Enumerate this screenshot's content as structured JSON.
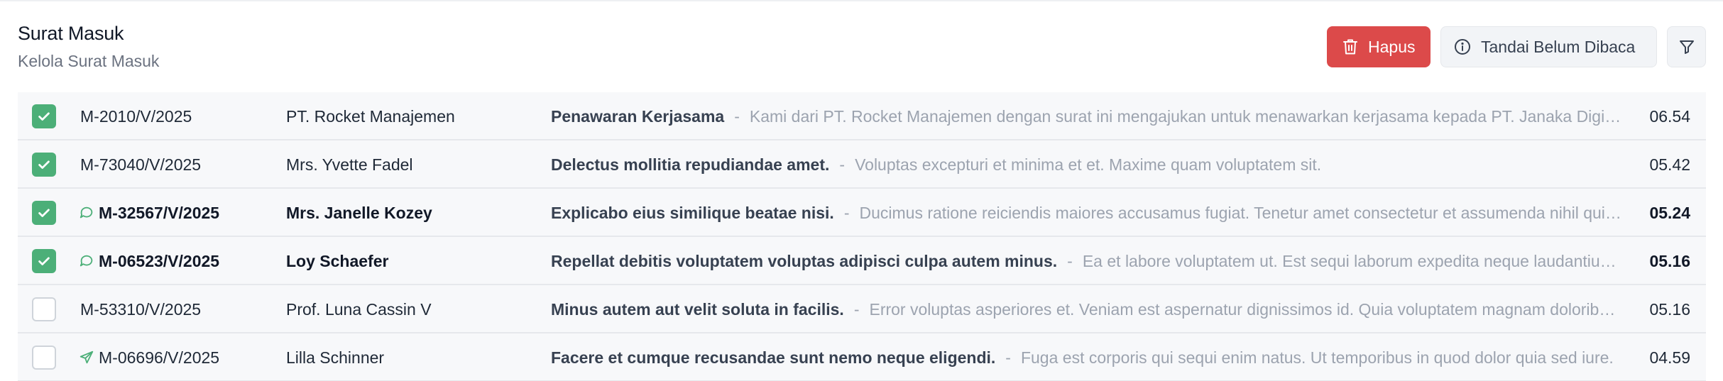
{
  "header": {
    "title": "Surat Masuk",
    "subtitle": "Kelola Surat Masuk",
    "delete_label": "Hapus",
    "mark_unread_label": "Tandai Belum Dibaca",
    "icons": {
      "delete": "trash-icon",
      "mark_unread": "info-circle-icon",
      "filter": "filter-icon"
    },
    "colors": {
      "delete_bg": "#dc4a4a",
      "checkbox_checked": "#4caf78"
    }
  },
  "rows": [
    {
      "checked": true,
      "icon": "",
      "code": "M-2010/V/2025",
      "sender": "PT. Rocket Manajemen",
      "subject": "Penawaran Kerjasama",
      "separator": "-",
      "preview": "Kami dari PT. Rocket Manajemen dengan surat ini mengajukan untuk menawarkan kerjasama kepada PT. Janaka Digital Solusindo untuk pengembangan produk",
      "time": "06.54",
      "unread": false
    },
    {
      "checked": true,
      "icon": "",
      "code": "M-73040/V/2025",
      "sender": "Mrs. Yvette Fadel",
      "subject": "Delectus mollitia repudiandae amet.",
      "separator": "-",
      "preview": "Voluptas excepturi et minima et et. Maxime quam voluptatem sit.",
      "time": "05.42",
      "unread": false
    },
    {
      "checked": true,
      "icon": "chat-bubble-icon",
      "code": "M-32567/V/2025",
      "sender": "Mrs. Janelle Kozey",
      "subject": "Explicabo eius similique beatae nisi.",
      "separator": "-",
      "preview": "Ducimus ratione reiciendis maiores accusamus fugiat. Tenetur amet consectetur et assumenda nihil quia aut.",
      "time": "05.24",
      "unread": true
    },
    {
      "checked": true,
      "icon": "chat-bubble-icon",
      "code": "M-06523/V/2025",
      "sender": "Loy Schaefer",
      "subject": "Repellat debitis voluptatem voluptas adipisci culpa autem minus.",
      "separator": "-",
      "preview": "Ea et labore voluptatem ut. Est sequi laborum expedita neque laudantium repellat.",
      "time": "05.16",
      "unread": true
    },
    {
      "checked": false,
      "icon": "",
      "code": "M-53310/V/2025",
      "sender": "Prof. Luna Cassin V",
      "subject": "Minus autem aut velit soluta in facilis.",
      "separator": "-",
      "preview": "Error voluptas asperiores et. Veniam est aspernatur dignissimos id. Quia voluptatem magnam doloribus qui.",
      "time": "05.16",
      "unread": false
    },
    {
      "checked": false,
      "icon": "send-icon",
      "code": "M-06696/V/2025",
      "sender": "Lilla Schinner",
      "subject": "Facere et cumque recusandae sunt nemo neque eligendi.",
      "separator": "-",
      "preview": "Fuga est corporis qui sequi enim natus. Ut temporibus in quod dolor quia sed iure.",
      "time": "04.59",
      "unread": false
    }
  ]
}
